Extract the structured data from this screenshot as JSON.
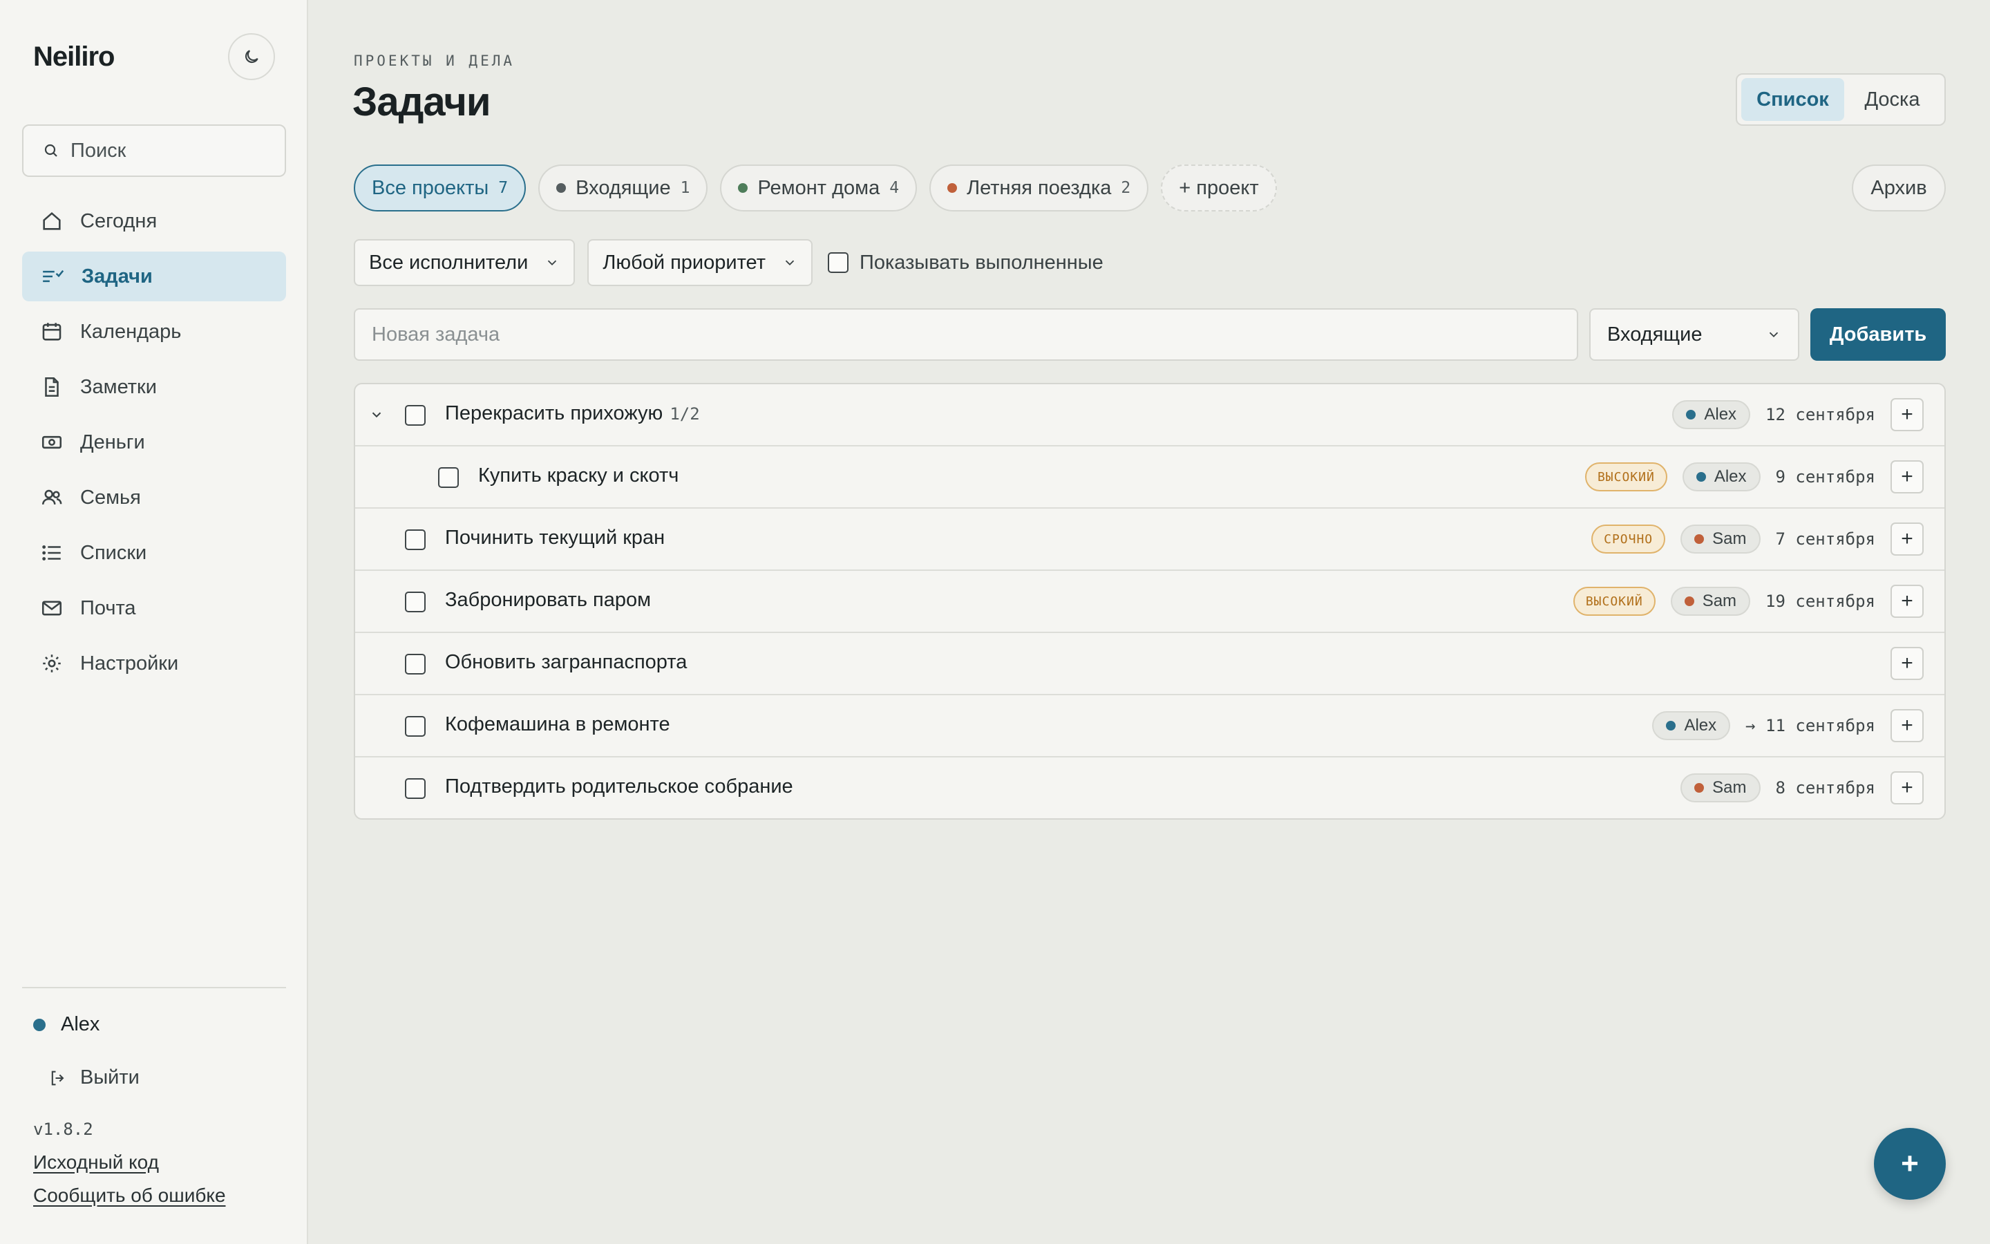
{
  "app": {
    "logo": "Neiliro",
    "version": "v1.8.2"
  },
  "sidebar": {
    "search_placeholder": "Поиск",
    "items": [
      {
        "label": "Сегодня",
        "icon": "home-icon"
      },
      {
        "label": "Задачи",
        "icon": "tasks-icon",
        "active": true
      },
      {
        "label": "Календарь",
        "icon": "calendar-icon"
      },
      {
        "label": "Заметки",
        "icon": "document-icon"
      },
      {
        "label": "Деньги",
        "icon": "money-icon"
      },
      {
        "label": "Семья",
        "icon": "users-icon"
      },
      {
        "label": "Списки",
        "icon": "list-icon"
      },
      {
        "label": "Почта",
        "icon": "mail-icon"
      },
      {
        "label": "Настройки",
        "icon": "gear-icon"
      }
    ],
    "user": "Alex",
    "logout": "Выйти",
    "source_link": "Исходный код",
    "report_link": "Сообщить об ошибке"
  },
  "header": {
    "kicker": "ПРОЕКТЫ И ДЕЛА",
    "title": "Задачи",
    "view_list": "Список",
    "view_board": "Доска"
  },
  "projects": [
    {
      "label": "Все проекты",
      "count": "7",
      "active": true
    },
    {
      "label": "Входящие",
      "count": "1",
      "color": "#555d5f"
    },
    {
      "label": "Ремонт дома",
      "count": "4",
      "color": "#4e7d5a"
    },
    {
      "label": "Летняя поездка",
      "count": "2",
      "color": "#c0603a"
    }
  ],
  "add_project": "+ проект",
  "archive": "Архив",
  "filters": {
    "assignee": "Все исполнители",
    "priority": "Любой приоритет",
    "show_done": "Показывать выполненные"
  },
  "new_task": {
    "placeholder": "Новая задача",
    "project": "Входящие",
    "add_button": "Добавить"
  },
  "tasks": [
    {
      "title": "Перекрасить прихожую",
      "subcount": "1/2",
      "person": "Alex",
      "date": "12 сентября",
      "priority": ""
    },
    {
      "title": "Купить краску и скотч",
      "subcount": "",
      "person": "Alex",
      "date": "9 сентября",
      "priority": "ВЫСОКИЙ"
    },
    {
      "title": "Починить текущий кран",
      "subcount": "",
      "person": "Sam",
      "date": "7 сентября",
      "priority": "СРОЧНО"
    },
    {
      "title": "Забронировать паром",
      "subcount": "",
      "person": "Sam",
      "date": "19 сентября",
      "priority": "ВЫСОКИЙ"
    },
    {
      "title": "Обновить загранпаспорта",
      "subcount": "",
      "person": "",
      "date": "",
      "priority": ""
    },
    {
      "title": "Кофемашина в ремонте",
      "subcount": "",
      "person": "Alex",
      "date": "→ 11 сентября",
      "priority": ""
    },
    {
      "title": "Подтвердить родительское собрание",
      "subcount": "",
      "person": "Sam",
      "date": "8 сентября",
      "priority": ""
    }
  ],
  "colors": {
    "accent": "#1f6583",
    "alex": "#2a6f8c",
    "sam": "#c0603a",
    "priority": "#b1701b"
  },
  "fab": "+"
}
